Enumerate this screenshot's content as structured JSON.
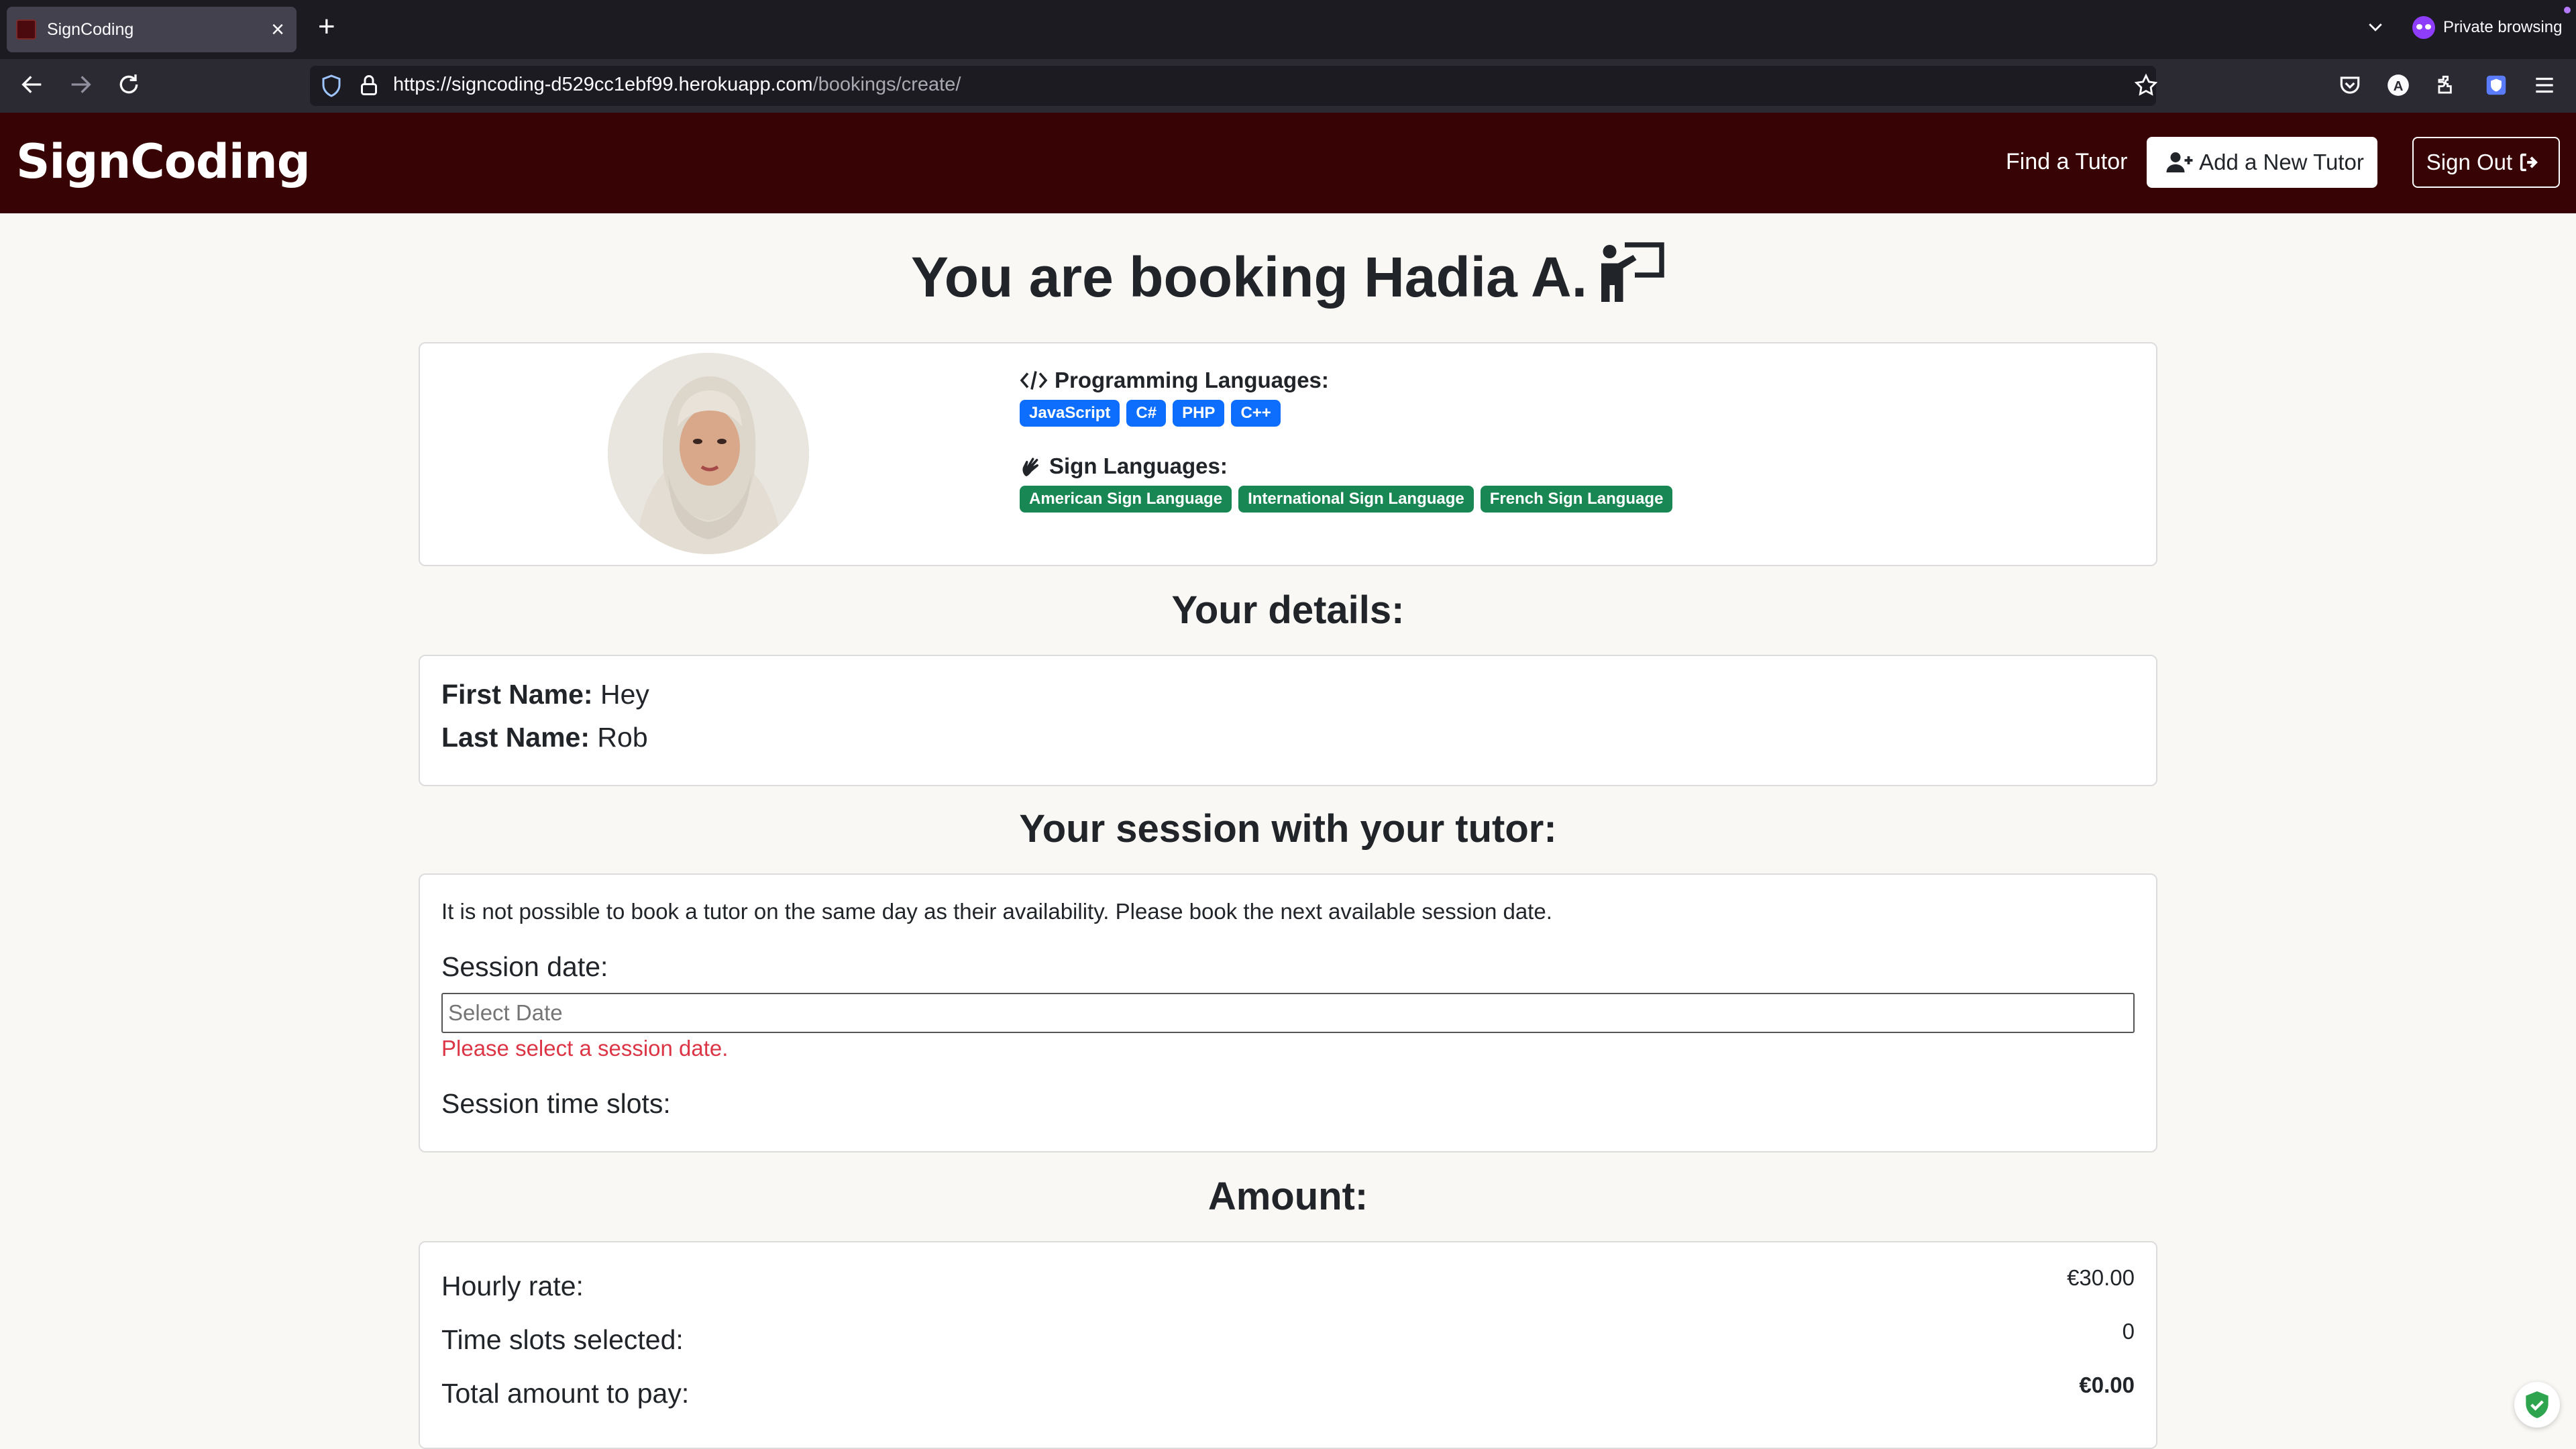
{
  "browser": {
    "tab_title": "SignCoding",
    "private_label": "Private browsing",
    "url_host": "https://signcoding-d529cc1ebf99.herokuapp.com",
    "url_path": "/bookings/create/"
  },
  "header": {
    "brand": "SignCoding",
    "find_tutor": "Find a Tutor",
    "add_tutor": "Add a New Tutor",
    "sign_out": "Sign Out"
  },
  "title": "You are booking Hadia A.",
  "tutor": {
    "programming_heading": "Programming Languages:",
    "programming": [
      "JavaScript",
      "C#",
      "PHP",
      "C++"
    ],
    "sign_heading": "Sign Languages:",
    "sign": [
      "American Sign Language",
      "International Sign Language",
      "French Sign Language"
    ]
  },
  "details": {
    "heading": "Your details:",
    "first_label": "First Name:",
    "first_value": "Hey",
    "last_label": "Last Name:",
    "last_value": "Rob"
  },
  "session": {
    "heading": "Your session with your tutor:",
    "note": "It is not possible to book a tutor on the same day as their availability. Please book the next available session date.",
    "date_label": "Session date:",
    "date_placeholder": "Select Date",
    "date_error": "Please select a session date.",
    "slots_label": "Session time slots:"
  },
  "amount": {
    "heading": "Amount:",
    "rate_label": "Hourly rate:",
    "rate_value": "€30.00",
    "slots_label": "Time slots selected:",
    "slots_value": "0",
    "total_label": "Total amount to pay:",
    "total_value": "€0.00"
  },
  "colors": {
    "header_bg": "#370304",
    "badge_blue": "#0d6efd",
    "badge_green": "#198754",
    "error": "#dc3545"
  }
}
